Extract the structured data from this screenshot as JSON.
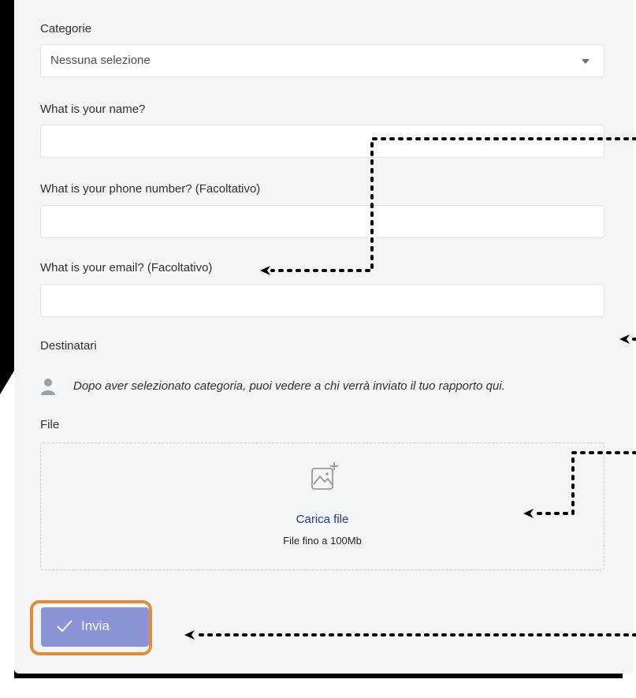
{
  "form": {
    "category": {
      "label": "Categorie",
      "selected": "Nessuna selezione"
    },
    "name": {
      "label": "What is your name?",
      "value": ""
    },
    "phone": {
      "label": "What is your phone number? (Facoltativo)",
      "value": ""
    },
    "email": {
      "label": "What is your email? (Facoltativo)",
      "value": ""
    },
    "recipients": {
      "label": "Destinatari",
      "icon": "person-icon",
      "note": "Dopo aver selezionato categoria, puoi vedere a chi verrà inviato il tuo rapporto qui."
    },
    "file": {
      "label": "File",
      "icon": "image-add-icon",
      "upload_label": "Carica file",
      "hint": "File fino a 100Mb"
    },
    "submit": {
      "label": "Invia",
      "icon": "check-icon"
    }
  },
  "colors": {
    "panel_bg": "#f4f5f7",
    "button_bg": "#8a93d6",
    "highlight": "#e28c3a",
    "link": "#1e3a8a"
  }
}
